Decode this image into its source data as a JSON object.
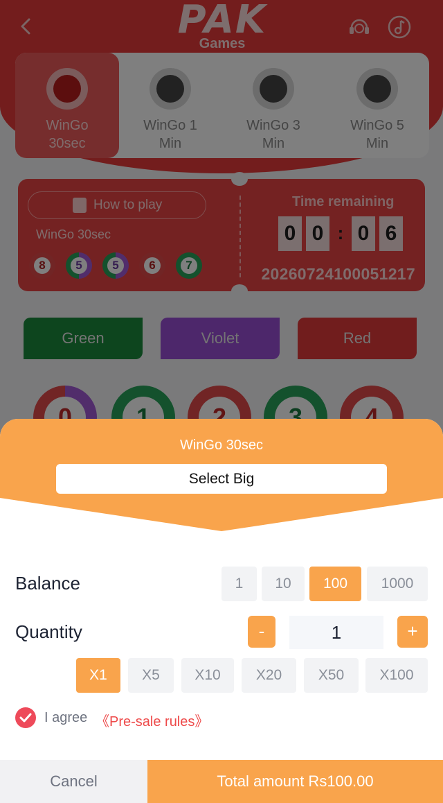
{
  "header": {
    "logo_big": "PAK",
    "logo_small": "Games",
    "brand_color": "#e63a3a"
  },
  "game_tabs": [
    {
      "label": "WinGo\n30sec",
      "active": true
    },
    {
      "label": "WinGo 1\nMin",
      "active": false
    },
    {
      "label": "WinGo 3\nMin",
      "active": false
    },
    {
      "label": "WinGo 5\nMin",
      "active": false
    }
  ],
  "ticket": {
    "how_to_play": "How to play",
    "game_name": "WinGo 30sec",
    "recent_results": [
      "8",
      "5",
      "5",
      "6",
      "7"
    ],
    "time_remaining_label": "Time remaining",
    "timer_digits": [
      "0",
      "0",
      "0",
      "6"
    ],
    "timer_colon": ":",
    "period_number": "20260724100051217"
  },
  "color_options": {
    "green": "Green",
    "violet": "Violet",
    "red": "Red"
  },
  "number_balls": [
    "0",
    "1",
    "2",
    "3",
    "4"
  ],
  "sheet": {
    "title": "WinGo 30sec",
    "selection": "Select Big",
    "balance_label": "Balance",
    "balance_options": [
      "1",
      "10",
      "100",
      "1000"
    ],
    "balance_selected": "100",
    "quantity_label": "Quantity",
    "minus": "-",
    "plus": "+",
    "quantity_value": "1",
    "multipliers": [
      "X1",
      "X5",
      "X10",
      "X20",
      "X50",
      "X100"
    ],
    "multiplier_selected": "X1",
    "agree_text": "I agree",
    "agree_link": "《Pre-sale rules》",
    "cancel": "Cancel",
    "total": "Total amount Rs100.00",
    "accent_color": "#f9a44c"
  }
}
